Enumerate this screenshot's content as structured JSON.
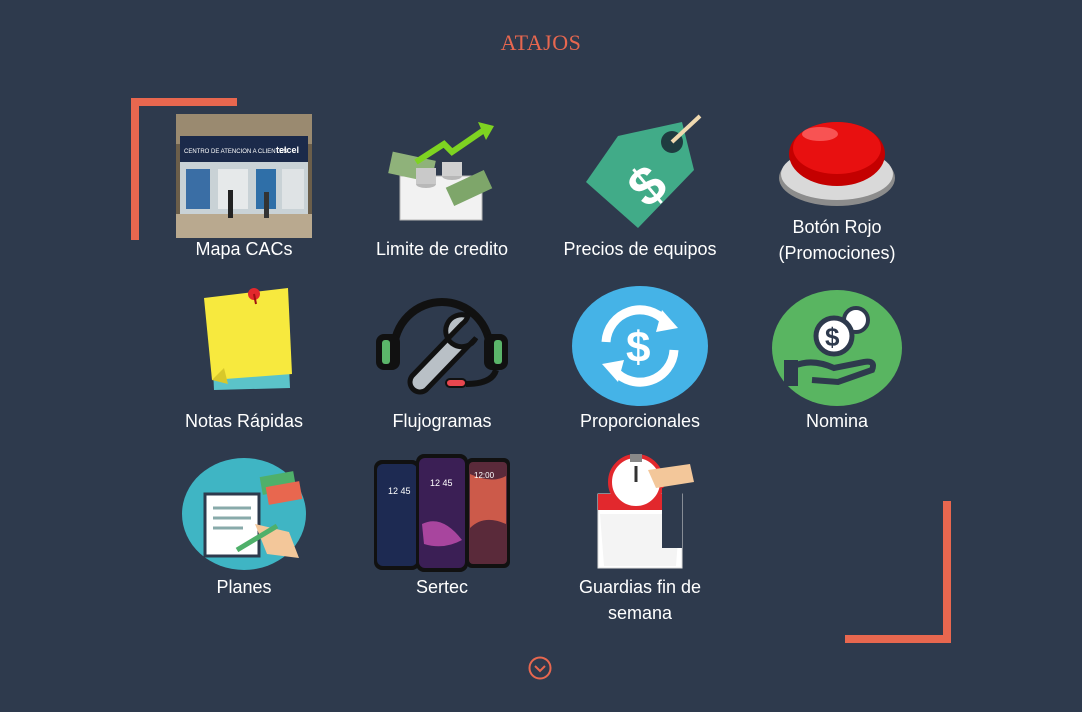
{
  "header": {
    "title": "ATAJOS"
  },
  "tiles": [
    {
      "label": "Mapa CACs",
      "icon": "store-photo",
      "photo_sign": "CENTRO DE ATENCION A CLIENTES",
      "photo_brand": "telcel"
    },
    {
      "label": "Limite de credito",
      "icon": "money-growth-icon"
    },
    {
      "label": "Precios de equipos",
      "icon": "price-tag-icon"
    },
    {
      "label": "Botón Rojo (Promociones)",
      "icon": "red-button-icon"
    },
    {
      "label": "Notas Rápidas",
      "icon": "sticky-note-icon"
    },
    {
      "label": "Flujogramas",
      "icon": "headset-wrench-icon"
    },
    {
      "label": "Proporcionales",
      "icon": "dollar-exchange-icon"
    },
    {
      "label": "Nomina",
      "icon": "hand-money-icon"
    },
    {
      "label": "Planes",
      "icon": "contract-signing-icon"
    },
    {
      "label": "Sertec",
      "icon": "smartphones-icon",
      "phone_times": [
        "12 45",
        "12 45",
        "12:00"
      ]
    },
    {
      "label": "Guardias fin de semana",
      "icon": "stopwatch-calendar-icon"
    }
  ],
  "footer": {
    "scroll_icon": "chevron-down-circle-icon"
  },
  "colors": {
    "background": "#2e3a4d",
    "accent": "#e8674f",
    "text": "#ffffff"
  }
}
